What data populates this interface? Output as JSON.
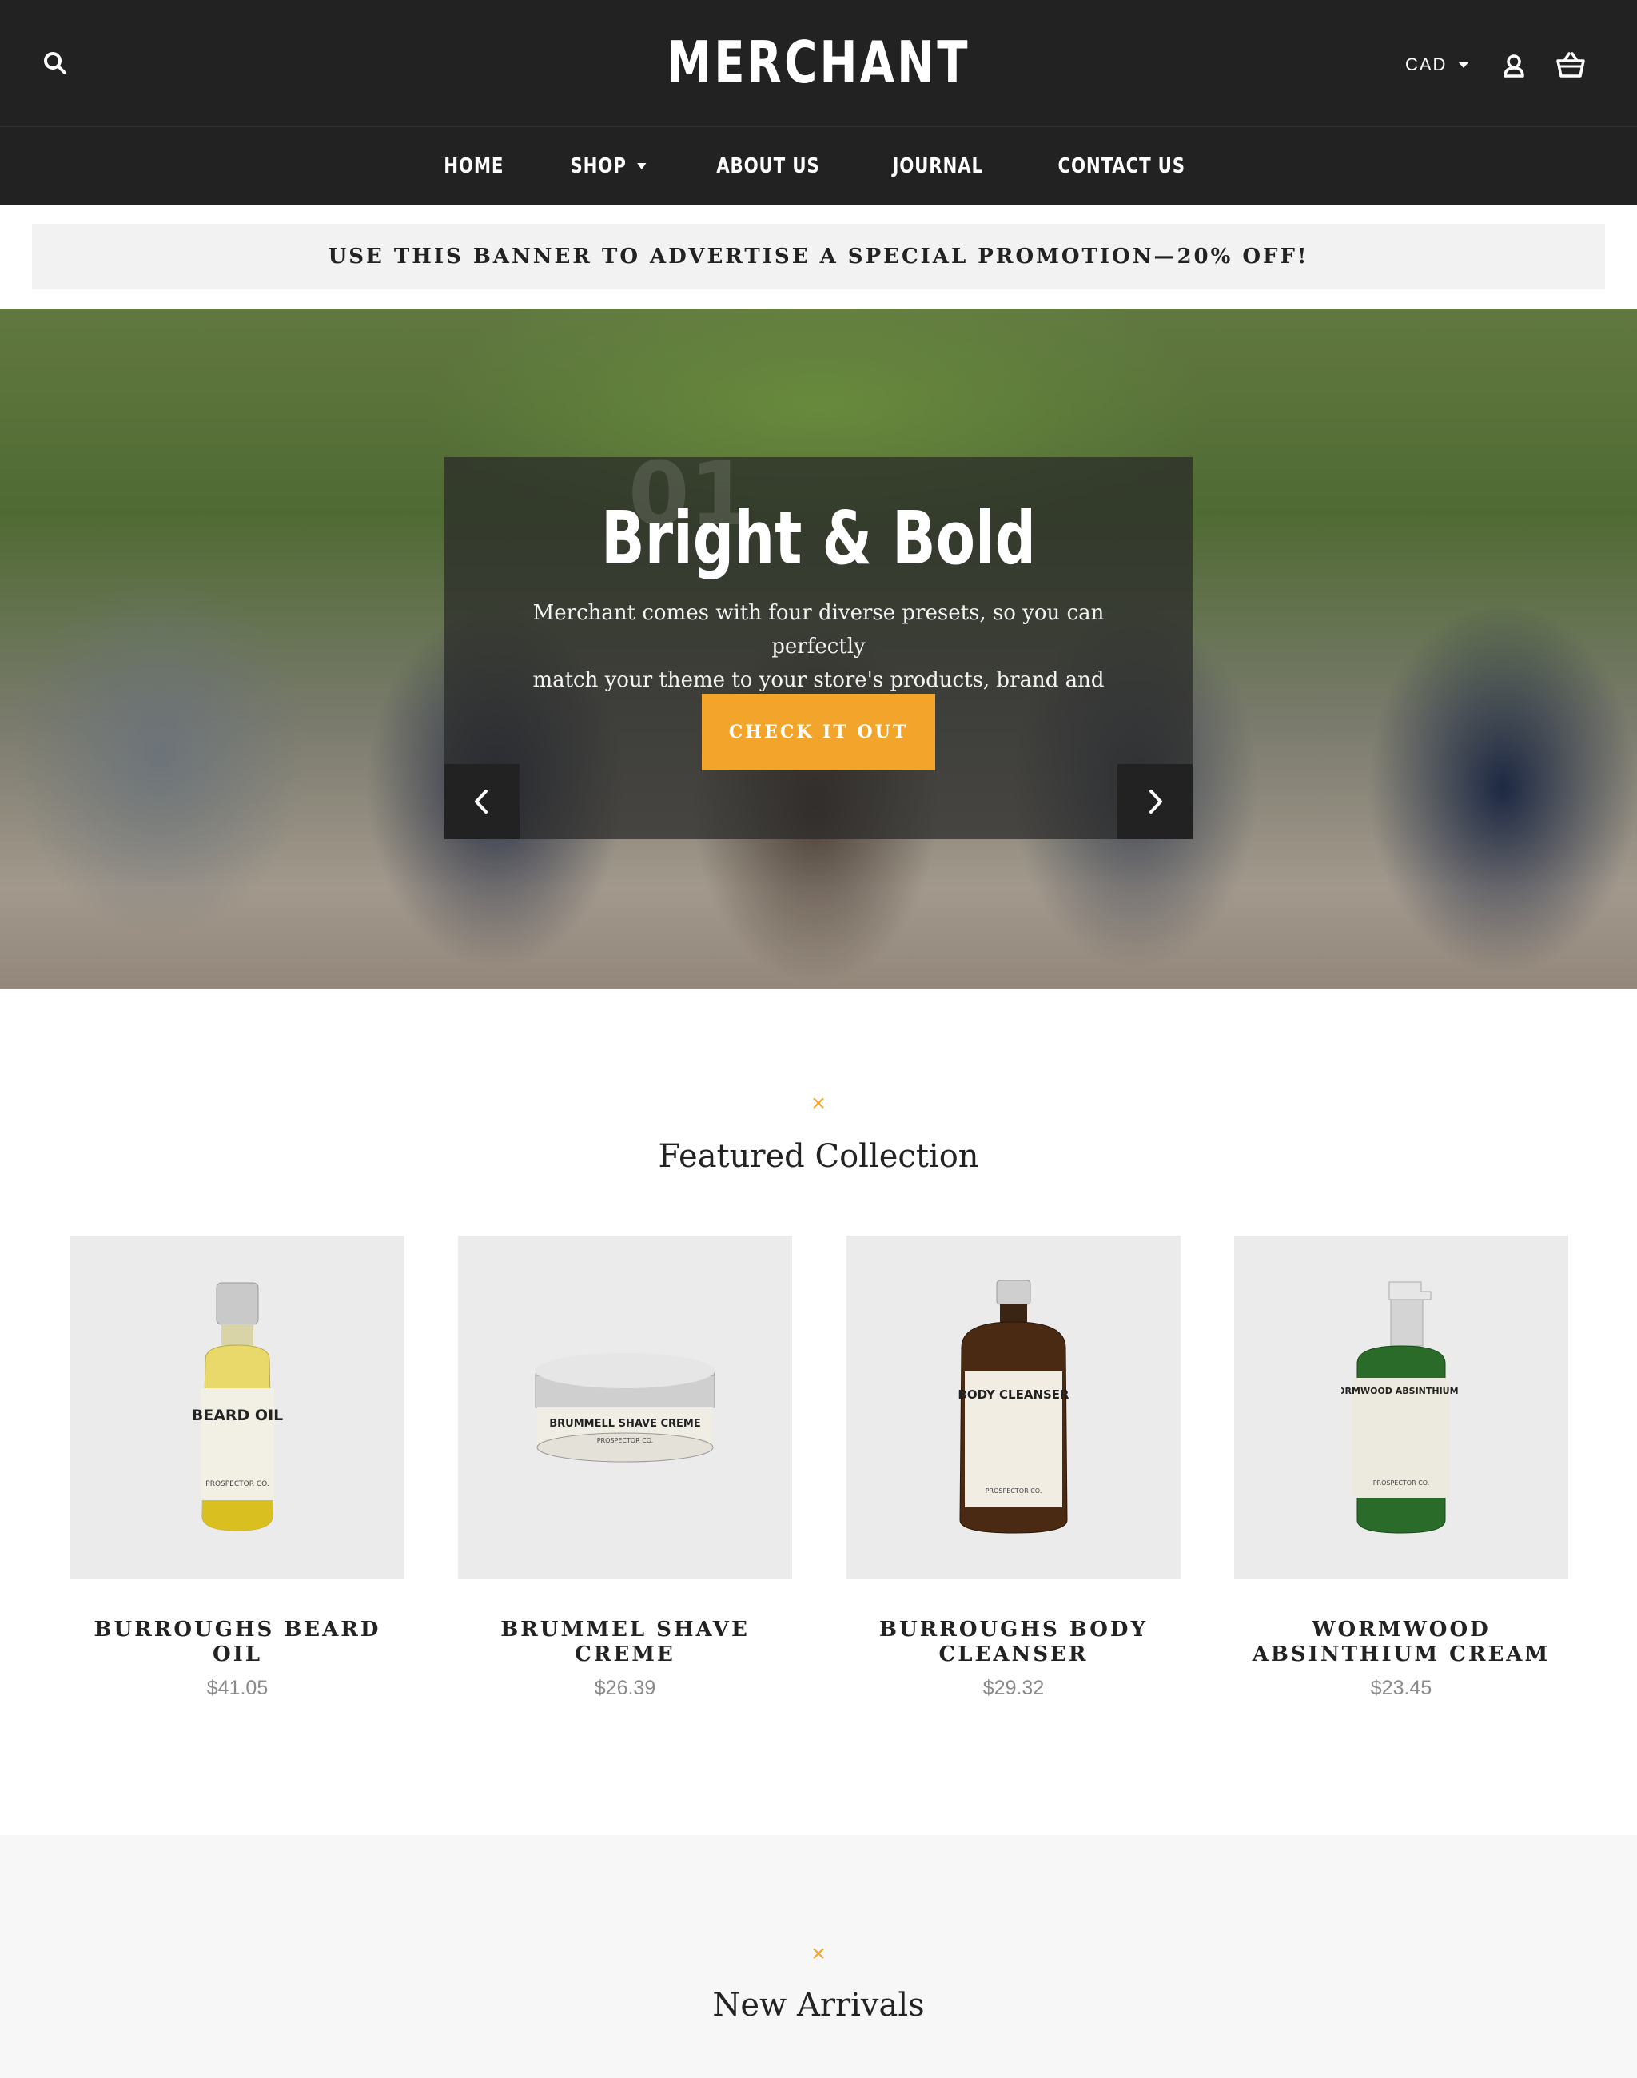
{
  "header": {
    "logo": "MERCHANT",
    "currency": "CAD"
  },
  "nav": {
    "items": [
      {
        "label": "HOME"
      },
      {
        "label": "SHOP"
      },
      {
        "label": "ABOUT US"
      },
      {
        "label": "JOURNAL"
      },
      {
        "label": "CONTACT US"
      }
    ]
  },
  "promo": {
    "text": "USE THIS BANNER TO ADVERTISE A SPECIAL PROMOTION—20% OFF!"
  },
  "hero": {
    "slide_number": "01",
    "title": "Bright & Bold",
    "text_line1": "Merchant comes with four diverse presets, so you can perfectly",
    "text_line2": "match your theme to your store's products, brand and vision.",
    "cta": "CHECK IT OUT"
  },
  "featured": {
    "mark": "×",
    "title": "Featured Collection",
    "products": [
      {
        "title": "BURROUGHS BEARD OIL",
        "price": "$41.05",
        "label_line1": "BEARD OIL",
        "brand": "PROSPECTOR CO."
      },
      {
        "title": "BRUMMEL SHAVE CREME",
        "price": "$26.39",
        "label_line1": "BRUMMELL SHAVE CREME",
        "brand": "PROSPECTOR CO."
      },
      {
        "title": "BURROUGHS BODY CLEANSER",
        "price": "$29.32",
        "label_line1": "BODY CLEANSER",
        "brand": "PROSPECTOR CO."
      },
      {
        "title": "WORMWOOD ABSINTHIUM CREAM",
        "price": "$23.45",
        "label_line1": "WORMWOOD ABSINTHIUM CR",
        "brand": "PROSPECTOR CO."
      }
    ]
  },
  "new_arrivals": {
    "mark": "×",
    "title": "New Arrivals"
  },
  "colors": {
    "header_bg": "#222222",
    "accent": "#f2a52a",
    "promo_bg": "#f2f2f2",
    "product_bg": "#ebebeb",
    "price": "#8a8a8a"
  },
  "icons": [
    "search-icon",
    "user-icon",
    "basket-icon",
    "chevron-left-icon",
    "chevron-right-icon",
    "caret-down-icon"
  ]
}
